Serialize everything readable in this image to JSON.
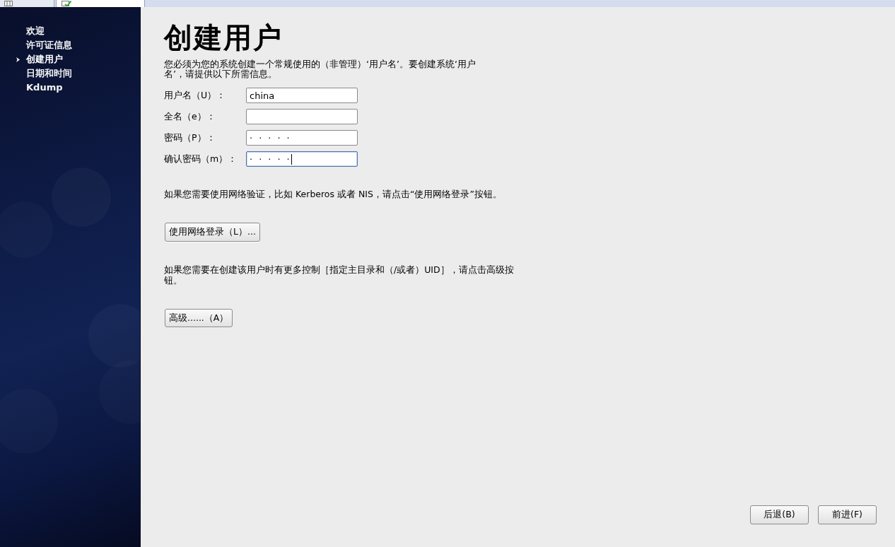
{
  "tabs": [
    {
      "selected": false
    },
    {
      "selected": true
    }
  ],
  "sidebar": {
    "items": [
      {
        "label": "欢迎",
        "selected": false
      },
      {
        "label": "许可证信息",
        "selected": false
      },
      {
        "label": "创建用户",
        "selected": true
      },
      {
        "label": "日期和时间",
        "selected": false
      },
      {
        "label": "Kdump",
        "selected": false
      }
    ]
  },
  "page": {
    "title": "创建用户",
    "intro": "您必须为您的系统创建一个常规使用的（非管理）‘用户名’。要创建系统‘用户名’，请提供以下所需信息。",
    "fields": [
      {
        "label": "用户名（U）：",
        "kind": "text",
        "value": "china",
        "focused": false
      },
      {
        "label": "全名（e）：",
        "kind": "text",
        "focused": false
      },
      {
        "label": "密码（P）：",
        "kind": "password",
        "value": "·····",
        "focused": false
      },
      {
        "label": "确认密码（m）：",
        "kind": "password",
        "value": "·····",
        "focused": true
      }
    ],
    "network_note": "如果您需要使用网络验证，比如 Kerberos 或者 NIS，请点击“使用网络登录”按钮。",
    "network_button": "使用网络登录（L）...",
    "advanced_note": "如果您需要在创建该用户时有更多控制［指定主目录和（/或者）UID］，请点击高级按钮。",
    "advanced_button": "高级......（A）"
  },
  "navigation": {
    "back": "后退(B)",
    "next": "前进(F)"
  }
}
